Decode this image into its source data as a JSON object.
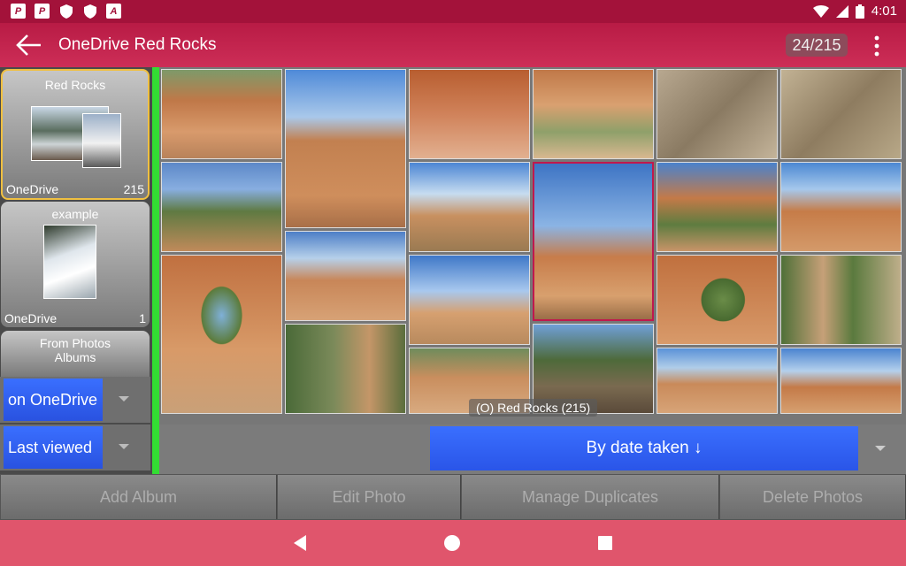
{
  "status_bar": {
    "time": "4:01",
    "left_icons": [
      "pinterest-icon",
      "pinterest-icon",
      "shield-icon",
      "shield-icon",
      "font-icon"
    ],
    "right_icons": [
      "wifi-icon",
      "signal-icon",
      "battery-icon"
    ]
  },
  "app_bar": {
    "title": "OneDrive Red Rocks",
    "counter": "24/215",
    "back_icon": "arrow-left-icon",
    "menu_icon": "more-vertical-icon"
  },
  "albums": [
    {
      "name": "Red Rocks",
      "source": "OneDrive",
      "count": "215",
      "selected": true
    },
    {
      "name": "example",
      "source": "OneDrive",
      "count": "1",
      "selected": false
    },
    {
      "name": "From Photos Albums",
      "source": "",
      "count": "",
      "selected": false
    }
  ],
  "filters": {
    "location": "on OneDrive",
    "order": "Last viewed"
  },
  "grid": {
    "caption": "(O) Red Rocks (215)"
  },
  "sort": {
    "label": "By date taken ↓"
  },
  "actions": {
    "add_album": "Add Album",
    "edit_photo": "Edit Photo",
    "manage_duplicates": "Manage Duplicates",
    "delete_photos": "Delete Photos"
  },
  "nav_bar": {
    "icons": [
      "back-triangle-icon",
      "home-circle-icon",
      "recents-square-icon"
    ]
  },
  "colors": {
    "status_bar": "#a3123a",
    "app_bar": "#c4234e",
    "accent_blue": "#3060ff",
    "nav_bar": "#e0556c",
    "scroll_indicator": "#33dd33"
  }
}
